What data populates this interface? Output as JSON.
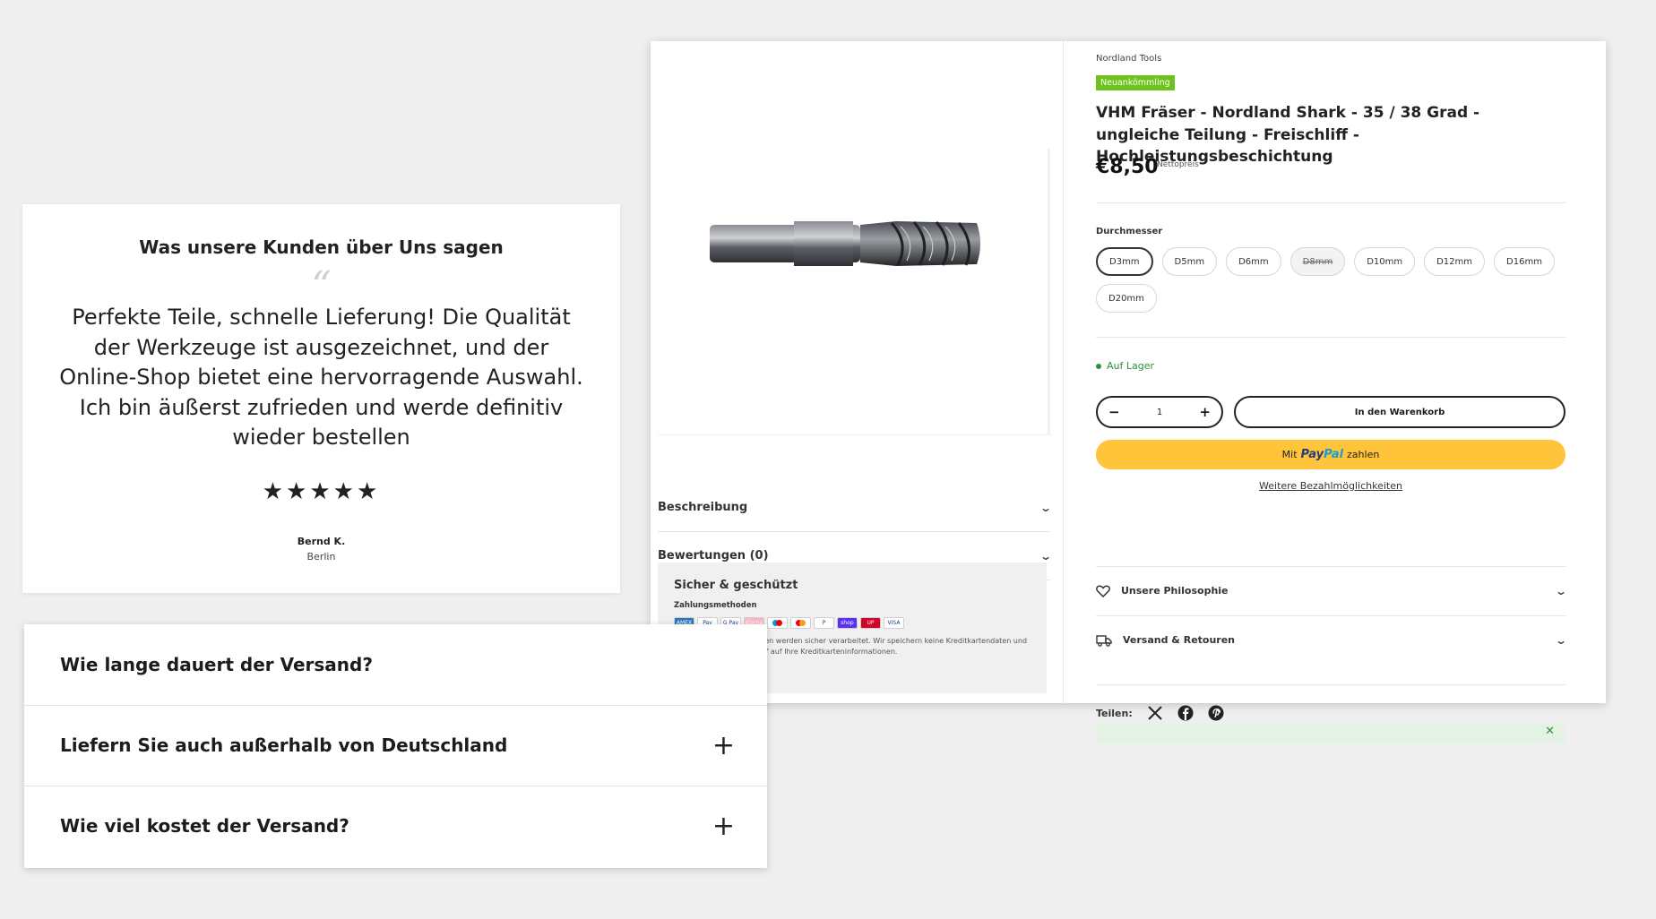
{
  "product": {
    "brand": "Nordland Tools",
    "badge": "Neuankömmling",
    "title": "VHM Fräser - Nordland Shark - 35 / 38 Grad - ungleiche Teilung - Freischliff - Hochleistungsbeschichtung",
    "price": "€8,50",
    "price_note": "Nettopreis",
    "option_label": "Durchmesser",
    "options": [
      "D3mm",
      "D5mm",
      "D6mm",
      "D8mm",
      "D10mm",
      "D12mm",
      "D16mm",
      "D20mm"
    ],
    "selected_option": "D3mm",
    "disabled_option": "D8mm",
    "stock": "Auf Lager",
    "quantity": "1",
    "add_to_cart": "In den Warenkorb",
    "paypal_prefix": "Mit",
    "paypal_logo_a": "Pay",
    "paypal_logo_b": "Pal",
    "paypal_suffix": "zahlen",
    "more_payments": "Weitere Bezahlmöglichkeiten",
    "left_accordions": [
      "Beschreibung",
      "Bewertungen (0)"
    ],
    "right_accordions": [
      "Unsere Philosophie",
      "Versand & Retouren"
    ],
    "share_label": "Teilen:",
    "secure": {
      "title": "Sicher & geschützt",
      "subtitle": "Zahlungsmethoden",
      "methods": [
        {
          "name": "amex",
          "label": "AMEX",
          "color": "#2e77bb"
        },
        {
          "name": "apple-pay",
          "label": "Pay",
          "color": "#ffffff"
        },
        {
          "name": "google-pay",
          "label": "G Pay",
          "color": "#ffffff"
        },
        {
          "name": "klarna",
          "label": "Klarna",
          "color": "#ffb3c7"
        },
        {
          "name": "maestro",
          "label": "",
          "color": "#ffffff"
        },
        {
          "name": "mastercard",
          "label": "",
          "color": "#ffffff"
        },
        {
          "name": "paypal",
          "label": "P",
          "color": "#ffffff"
        },
        {
          "name": "shop-pay",
          "label": "shop",
          "color": "#5a31f4"
        },
        {
          "name": "union-pay",
          "label": "UP",
          "color": "#d10429"
        },
        {
          "name": "visa",
          "label": "VISA",
          "color": "#ffffff"
        }
      ],
      "note": "Ihre Zahlungsinformationen werden sicher verarbeitet. Wir speichern keine Kreditkartendaten und haben auch keinen Zugriff auf Ihre Kreditkarteninformationen."
    }
  },
  "review": {
    "heading": "Was unsere Kunden über Uns sagen",
    "quote_mark": "“",
    "text": "Perfekte Teile, schnelle Lieferung! Die Qualität der Werkzeuge ist ausgezeichnet, und der Online-Shop bietet eine hervorragende Auswahl. Ich bin äußerst zufrieden und werde definitiv wieder bestellen",
    "rating": 5,
    "stars": "★★★★★",
    "name": "Bernd K.",
    "location": "Berlin"
  },
  "faq": {
    "items": [
      {
        "question": "Wie lange dauert der Versand?",
        "expanded": true
      },
      {
        "question": "Liefern Sie auch außerhalb von Deutschland",
        "expanded": false
      },
      {
        "question": "Wie viel kostet der Versand?",
        "expanded": false
      }
    ],
    "expand_icon": "+"
  }
}
